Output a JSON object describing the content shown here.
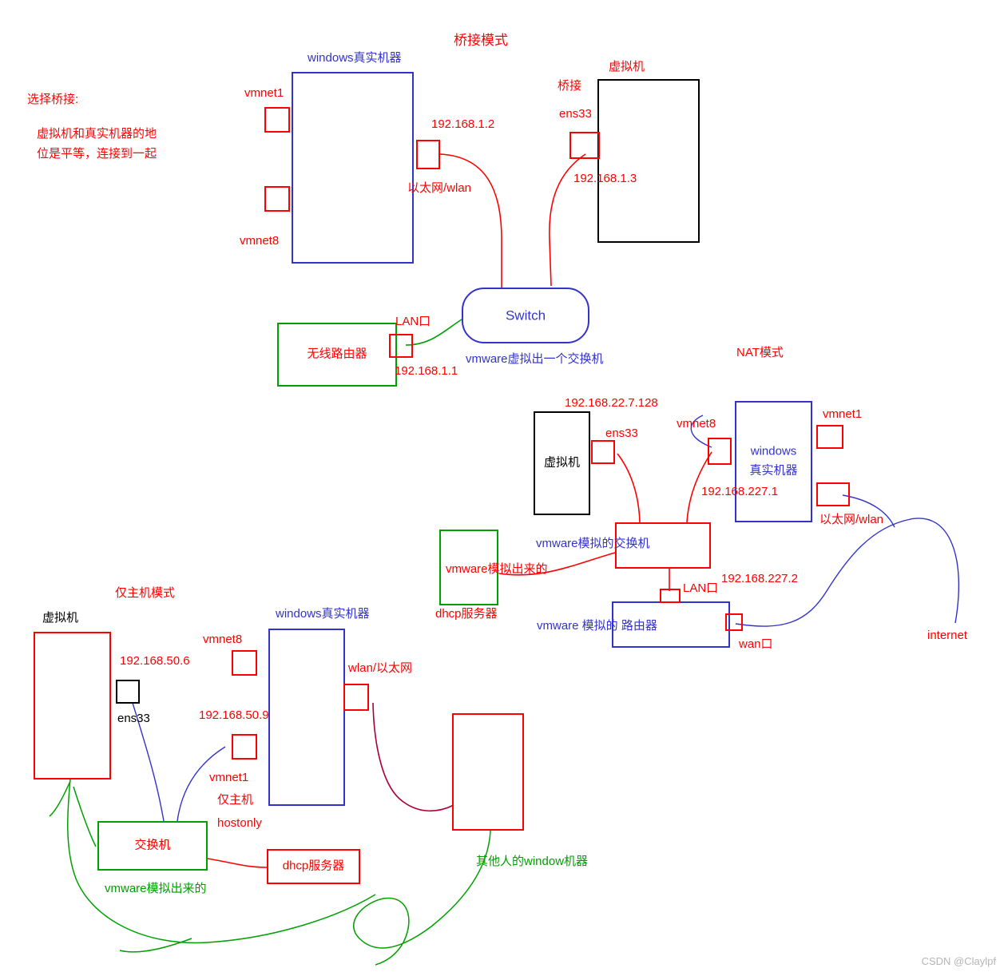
{
  "diagram": {
    "title_bridge": "桥接模式",
    "title_nat": "NAT模式",
    "title_hostonly": "仅主机模式",
    "watermark": "CSDN @Claylpf"
  },
  "bridge": {
    "note_line1": "选择桥接:",
    "note_line2": "虚拟机和真实机器的地",
    "note_line3": "位是平等，连接到一起",
    "windows_host_title": "windows真实机器",
    "vmnet1": "vmnet1",
    "vmnet8": "vmnet8",
    "ip_host": "192.168.1.2",
    "nic_label": "以太网/wlan",
    "vm_title": "虚拟机",
    "bridge_label": "桥接",
    "ens33": "ens33",
    "ip_vm": "192.168.1.3",
    "switch_label": "Switch",
    "switch_note": "vmware虚拟出一个交换机",
    "router_label": "无线路由器",
    "lan_port": "LAN口",
    "ip_router": "192.168.1.1"
  },
  "nat": {
    "vm_title": "虚拟机",
    "ip_vm": "192.168.22.7.128",
    "ens33": "ens33",
    "vmnet8": "vmnet8",
    "vmnet1": "vmnet1",
    "windows_host_title_l1": "windows",
    "windows_host_title_l2": "真实机器",
    "ip_host": "192.168.227.1",
    "nic_label": "以太网/wlan",
    "switch_label": "vmware模拟的交换机",
    "dhcp_box_l1": "vmware模拟出来的",
    "dhcp_box_l2": "dhcp服务器",
    "ip_router_lan": "192.168.227.2",
    "lan_port": "LAN口",
    "router_label": "vmware 模拟的 路由器",
    "wan_port": "wan口",
    "internet": "internet"
  },
  "hostonly": {
    "vm_title": "虚拟机",
    "ip_vm": "192.168.50.6",
    "ens33": "ens33",
    "windows_host_title": "windows真实机器",
    "vmnet8": "vmnet8",
    "nic_label": "wlan/以太网",
    "ip_vmnet1": "192.168.50.9",
    "vmnet1": "vmnet1",
    "hostonly_l1": "仅主机",
    "hostonly_l2": "hostonly",
    "switch_label": "交换机",
    "switch_note": "vmware模拟出来的",
    "dhcp_label": "dhcp服务器",
    "other_pc_label": "其他人的window机器"
  }
}
